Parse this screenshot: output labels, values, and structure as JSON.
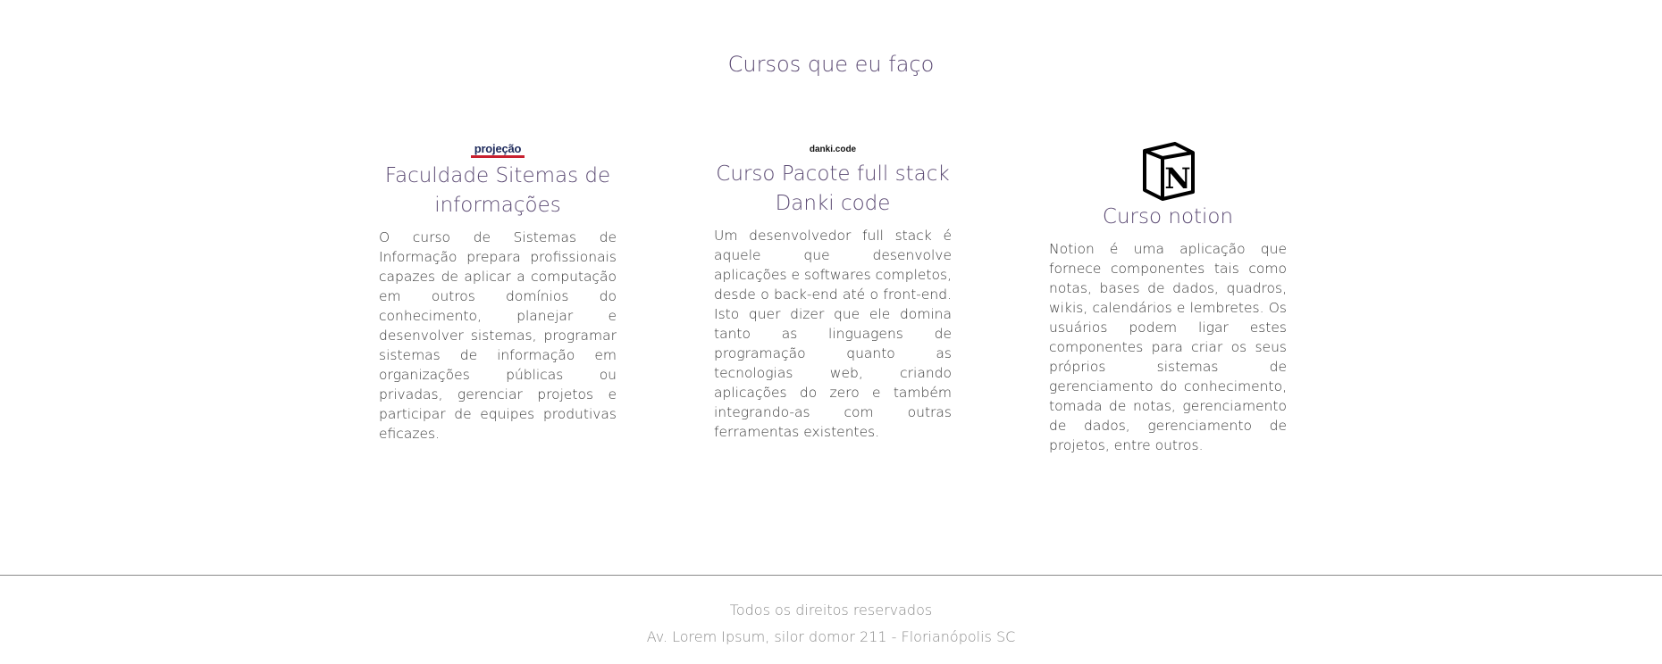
{
  "section": {
    "title": "Cursos que eu faço"
  },
  "courses": [
    {
      "logo_text": "projeção",
      "title": "Faculdade Sitemas de informações",
      "description": "O curso de Sistemas de Informação prepara profissionais capazes de aplicar a computação em outros domínios do conhecimento, planejar e desenvolver sistemas, programar sistemas de informação em organizações públicas ou privadas, gerenciar projetos e participar de equipes produtivas eficazes."
    },
    {
      "logo_text": "danki.code",
      "title": "Curso Pacote full stack Danki code",
      "description": "Um desenvolvedor full stack é aquele que desenvolve aplicações e softwares completos, desde o back-end até o front-end. Isto quer dizer que ele domina tanto as linguagens de programação quanto as tecnologias web, criando aplicações do zero e também integrando-as com outras ferramentas existentes."
    },
    {
      "logo_text": "N",
      "title": "Curso notion",
      "description": "Notion é uma aplicação que fornece componentes tais como notas, bases de dados, quadros, wikis, calendários e lembretes. Os usuários podem ligar estes componentes para criar os seus próprios sistemas de gerenciamento do conhecimento, tomada de notas, gerenciamento de dados, gerenciamento de projetos, entre outros."
    }
  ],
  "footer": {
    "rights": "Todos os direitos reservados",
    "address": "Av. Lorem Ipsum, silor domor 211 - Florianópolis SC"
  },
  "colors": {
    "heading": "#5b4a73",
    "body_text": "#3a3a3a",
    "footer_text": "#8b8b8b",
    "projecao_blue": "#1e2a5c",
    "projecao_red": "#c8202f"
  },
  "icons": [
    "projecao-logo",
    "danki-code-logo",
    "notion-logo"
  ]
}
